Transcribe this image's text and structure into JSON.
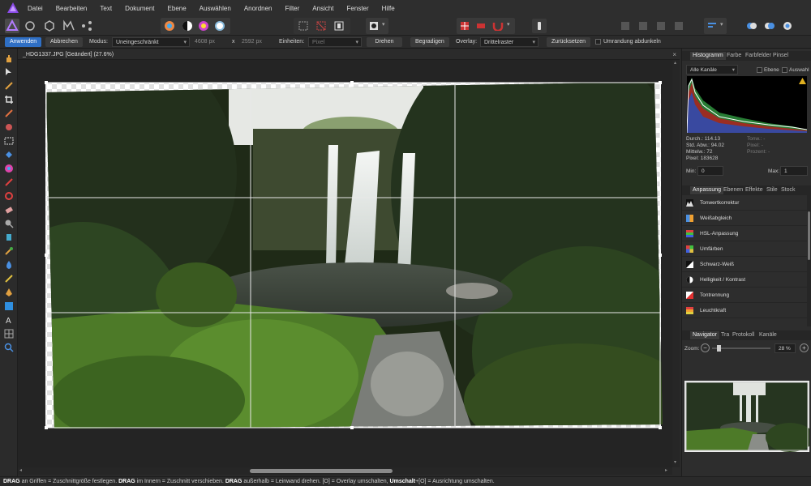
{
  "menu": [
    "Datei",
    "Bearbeiten",
    "Text",
    "Dokument",
    "Ebene",
    "Auswählen",
    "Anordnen",
    "Filter",
    "Ansicht",
    "Fenster",
    "Hilfe"
  ],
  "context": {
    "apply": "Anwenden",
    "cancel": "Abbrechen",
    "mode_label": "Modus:",
    "mode_value": "Uneingeschränkt",
    "width": "4608 px",
    "x": "x",
    "height": "2592 px",
    "units_label": "Einheiten:",
    "units_value": "Pixel",
    "rotate": "Drehen",
    "straighten": "Begradigen",
    "overlay_label": "Overlay:",
    "overlay_value": "Drittelraster",
    "reset": "Zurücksetzen",
    "darken": "Umrandung abdunkeln"
  },
  "document": {
    "title": "_HDG1337.JPG [Geändert] (27.6%)",
    "close": "×"
  },
  "histogram": {
    "tabs": [
      "Histogramm",
      "Farbe",
      "Farbfelder",
      "Pinsel"
    ],
    "channel": "Alle Kanäle",
    "layer": "Ebene",
    "selection": "Auswahl",
    "stats_left": [
      "Durch.: 114.13",
      "Std. Abw.: 94.02",
      "Mittelw.: 72",
      "Pixel: 183628"
    ],
    "stats_right": [
      "Tonw.: -",
      "Pixel: -",
      "Prozent: -"
    ],
    "min_label": "Min:",
    "min_value": "0",
    "max_label": "Max:",
    "max_value": "1"
  },
  "adjust": {
    "tabs": [
      "Anpassung",
      "Ebenen",
      "Effekte",
      "Stile",
      "Stock"
    ],
    "items": [
      "Tonwertkorrektur",
      "Weißabgleich",
      "HSL-Anpassung",
      "Umfärben",
      "Schwarz-Weiß",
      "Helligkeit / Kontrast",
      "Tontrennung",
      "Leuchtkraft"
    ]
  },
  "navigator": {
    "tabs": [
      "Navigator",
      "Tra",
      "Protokoll",
      "Kanäle"
    ],
    "zoom_label": "Zoom:",
    "zoom_value": "28 %",
    "minus": "−",
    "plus": "+"
  },
  "status": {
    "p1": "DRAG",
    "t1": " an Griffen = Zuschnittgröße festlegen. ",
    "p2": "DRAG",
    "t2": " im Innern = Zuschnitt verschieben. ",
    "p3": "DRAG",
    "t3": " außerhalb = Leinwand drehen. [O] = Overlay umschalten, ",
    "p4": "Umschalt",
    "t4": "+[O] = Ausrichtung umschalten."
  },
  "colors": {
    "accent": "#2f6fc4",
    "brand": "#7b3fe4",
    "canvas_bg": "#242424"
  }
}
